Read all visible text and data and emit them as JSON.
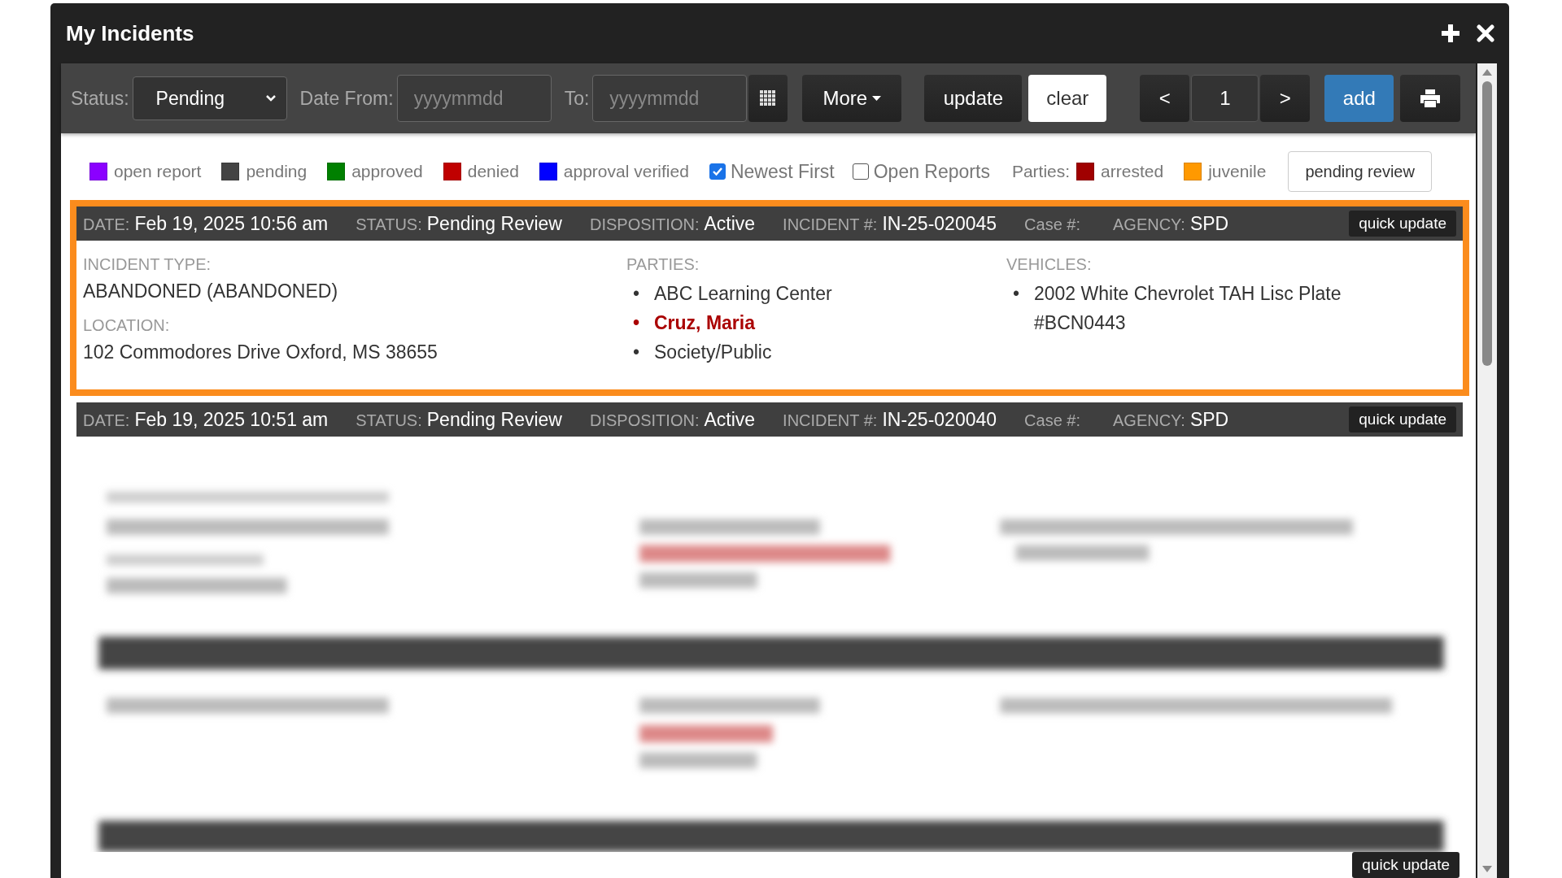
{
  "window": {
    "title": "My Incidents"
  },
  "toolbar": {
    "status_label": "Status:",
    "status_value": "Pending",
    "date_from_label": "Date From:",
    "date_from_placeholder": "yyyymmdd",
    "to_label": "To:",
    "to_placeholder": "yyyymmdd",
    "more": "More",
    "update": "update",
    "clear": "clear",
    "prev": "<",
    "page": "1",
    "next": ">",
    "add": "add"
  },
  "legend": [
    {
      "label": "open report",
      "color": "#8b00ff"
    },
    {
      "label": "pending",
      "color": "#444444"
    },
    {
      "label": "approved",
      "color": "#008000"
    },
    {
      "label": "denied",
      "color": "#c00000"
    },
    {
      "label": "approval verified",
      "color": "#0000ff"
    }
  ],
  "filters": [
    {
      "label": "Newest First",
      "checked": true
    },
    {
      "label": "Open Reports",
      "checked": false
    }
  ],
  "parties_label": "Parties:",
  "party_legend": [
    {
      "label": "arrested",
      "color": "#a00000"
    },
    {
      "label": "juvenile",
      "color": "#ff9900"
    }
  ],
  "pending_review_button": "pending review",
  "incidents": [
    {
      "selected": true,
      "header": [
        {
          "label": "DATE:",
          "value": "Feb 19, 2025 10:56 am"
        },
        {
          "label": "STATUS:",
          "value": "Pending Review"
        },
        {
          "label": "DISPOSITION:",
          "value": "Active"
        },
        {
          "label": "INCIDENT #:",
          "value": "IN-25-020045"
        },
        {
          "label": "Case #:"
        },
        {
          "label": "AGENCY:",
          "value": "SPD"
        }
      ],
      "quick_update": "quick update",
      "incident_type_label": "INCIDENT TYPE:",
      "incident_type": "ABANDONED (ABANDONED)",
      "location_label": "LOCATION:",
      "location": "102 Commodores Drive Oxford, MS 38655",
      "parties_label": "PARTIES:",
      "parties": [
        {
          "marker": "•",
          "name": "ABC Learning Center",
          "arrested": false
        },
        {
          "marker": "•",
          "name": "Cruz, Maria",
          "arrested": true
        },
        {
          "marker": "•",
          "name": "Society/Public",
          "arrested": false
        }
      ],
      "vehicles_label": "VEHICLES:",
      "vehicles": [
        {
          "marker": "•",
          "text": "2002 White Chevrolet TAH Lisc Plate #BCN0443"
        }
      ]
    },
    {
      "selected": false,
      "header": [
        {
          "label": "DATE:",
          "value": "Feb 19, 2025 10:51 am"
        },
        {
          "label": "STATUS:",
          "value": "Pending Review"
        },
        {
          "label": "DISPOSITION:",
          "value": "Active"
        },
        {
          "label": "INCIDENT #:",
          "value": "IN-25-020040"
        },
        {
          "label": "Case #:"
        },
        {
          "label": "AGENCY:",
          "value": "SPD"
        }
      ],
      "quick_update": "quick update"
    }
  ],
  "footer_button": "quick update"
}
